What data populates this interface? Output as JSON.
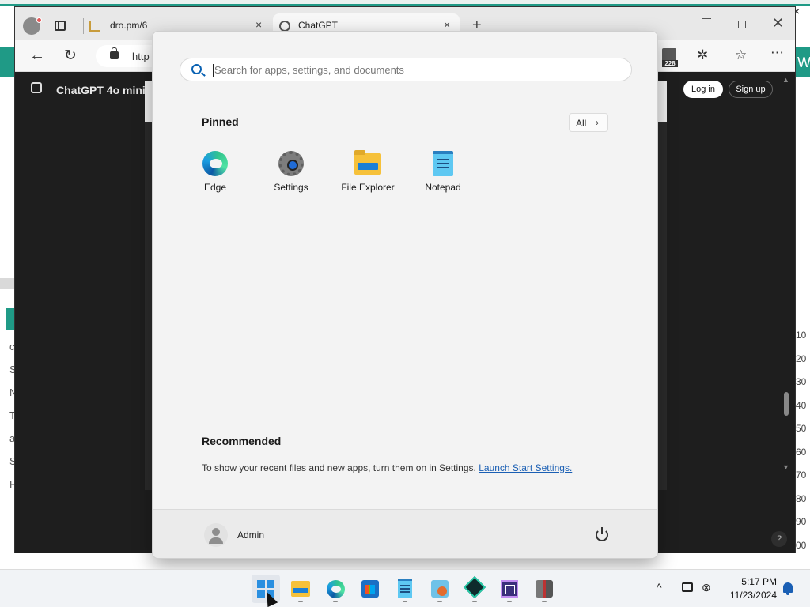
{
  "background_page": {
    "right_edge_letter": "W",
    "left_letters": [
      "c",
      "S",
      "N",
      "T",
      "a",
      "S",
      "F"
    ],
    "right_numbers": [
      "10",
      "20",
      "30",
      "40",
      "50",
      "60",
      "70",
      "80",
      "90",
      "00"
    ],
    "close_symbol": "×"
  },
  "browser": {
    "tabs": [
      {
        "title": "dro.pm/6",
        "close": "×"
      },
      {
        "title": "ChatGPT",
        "close": "×"
      }
    ],
    "new_tab": "+",
    "window_close": "✕",
    "url_text": "http",
    "extension_badge": "228",
    "more_menu": "⋯",
    "chat": {
      "model_label": "ChatGPT 4o mini",
      "login": "Log in",
      "signup": "Sign up",
      "help": "?"
    }
  },
  "start_menu": {
    "search": {
      "placeholder": "Search for apps, settings, and documents",
      "value": ""
    },
    "pinned": {
      "title": "Pinned",
      "all_button": "All",
      "all_chevron": "›",
      "apps": [
        {
          "label": "Edge",
          "icon": "edge-icon"
        },
        {
          "label": "Settings",
          "icon": "gear-icon"
        },
        {
          "label": "File Explorer",
          "icon": "folder-icon"
        },
        {
          "label": "Notepad",
          "icon": "notepad-icon"
        }
      ]
    },
    "recommended": {
      "title": "Recommended",
      "message": "To show your recent files and new apps, turn them on in Settings.",
      "link": "Launch Start Settings."
    },
    "user": {
      "name": "Admin"
    }
  },
  "taskbar": {
    "apps": [
      {
        "name": "start",
        "icon": "windows-logo-icon",
        "active": true
      },
      {
        "name": "file-explorer",
        "icon": "folder-icon"
      },
      {
        "name": "edge",
        "icon": "edge-icon"
      },
      {
        "name": "microsoft-store",
        "icon": "store-icon"
      },
      {
        "name": "notepad",
        "icon": "notepad-icon"
      },
      {
        "name": "app-6",
        "icon": "app-icon"
      },
      {
        "name": "app-7",
        "icon": "app-icon"
      },
      {
        "name": "app-8",
        "icon": "app-icon"
      },
      {
        "name": "app-9",
        "icon": "app-icon"
      }
    ],
    "tray": {
      "chevron": "^",
      "time": "5:17 PM",
      "date": "11/23/2024"
    }
  },
  "colors": {
    "accent_blue": "#0a62b3",
    "link_blue": "#1a5fb4",
    "teal": "#1f9a86",
    "chat_background": "#1e1e1e"
  }
}
